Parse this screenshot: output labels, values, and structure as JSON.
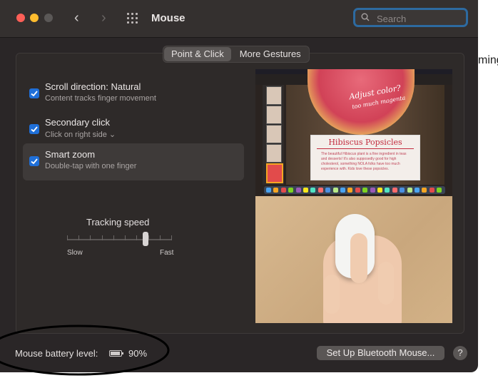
{
  "background": {
    "edge_text": "ming"
  },
  "window": {
    "title": "Mouse",
    "search": {
      "placeholder": "Search",
      "value": ""
    }
  },
  "tabs": [
    {
      "label": "Point & Click",
      "active": true
    },
    {
      "label": "More Gestures",
      "active": false
    }
  ],
  "options": [
    {
      "title": "Scroll direction: Natural",
      "subtitle": "Content tracks finger movement",
      "checked": true,
      "highlighted": false
    },
    {
      "title": "Secondary click",
      "subtitle": "Click on right side ⌄",
      "checked": true,
      "highlighted": false
    },
    {
      "title": "Smart zoom",
      "subtitle": "Double-tap with one finger",
      "checked": true,
      "highlighted": true
    }
  ],
  "tracking": {
    "label": "Tracking speed",
    "min_label": "Slow",
    "max_label": "Fast",
    "tick_count": 10,
    "level_fraction": 0.75
  },
  "preview": {
    "card_title": "Hibiscus Popsicles",
    "card_body": "The beautiful Hibiscus plant is a fine ingredient in teas and desserts! It's also supposedly good for high cholesterol, something NOLA folks have too much experience with. Kids love these popsicles.",
    "annotation_line1": "Adjust color?",
    "annotation_line2": "too much magenta"
  },
  "footer": {
    "battery_label": "Mouse battery level:",
    "battery_value": "90%",
    "battery_level": 0.9,
    "setup_button": "Set Up Bluetooth Mouse...",
    "help_button": "?"
  },
  "colors": {
    "accent_blue": "#1f6fd8",
    "window_bg": "#2a2627",
    "annotation_stroke": "#000000"
  }
}
